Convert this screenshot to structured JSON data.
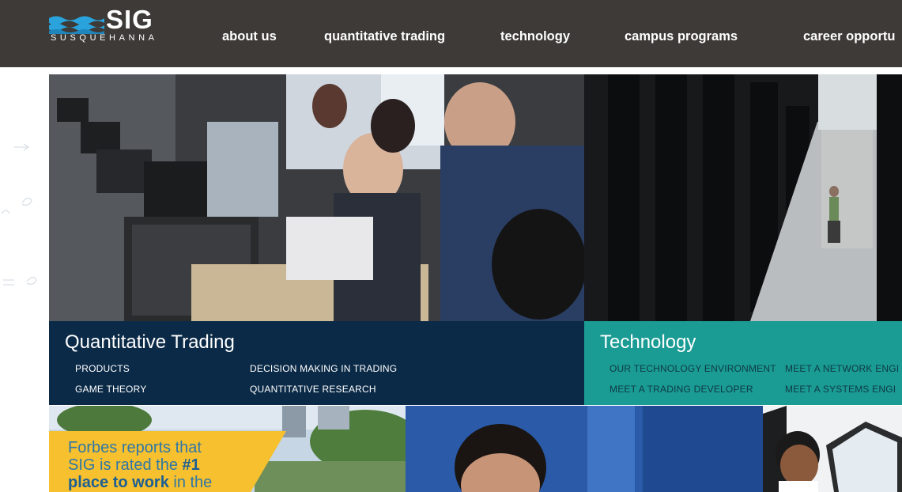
{
  "brand": {
    "name": "SIG",
    "subtitle": "SUSQUEHANNA",
    "colors": {
      "header": "#3d3a37",
      "wave": "#2aa3dc",
      "navy": "#0b2a47",
      "teal": "#1a9b94",
      "forbes_yellow": "#f6c02e"
    }
  },
  "nav": {
    "items": [
      {
        "label": "about us"
      },
      {
        "label": "quantitative trading"
      },
      {
        "label": "technology"
      },
      {
        "label": "campus programs"
      },
      {
        "label": "career opportu"
      }
    ]
  },
  "quant_panel": {
    "title": "Quantitative Trading",
    "links": [
      "PRODUCTS",
      "DECISION MAKING IN TRADING",
      "GAME THEORY",
      "QUANTITATIVE RESEARCH"
    ]
  },
  "tech_panel": {
    "title": "Technology",
    "links": [
      "OUR TECHNOLOGY ENVIRONMENT",
      "MEET A NETWORK ENGI",
      "MEET A TRADING DEVELOPER",
      "MEET A SYSTEMS ENGI"
    ]
  },
  "forbes": {
    "line1": "Forbes reports that",
    "line2_pre": "SIG is rated the ",
    "line2_bold": "#1",
    "line3_bold": "place to work",
    "line3_post": " in the"
  },
  "icons": [
    "sig-waves-logo-icon"
  ]
}
